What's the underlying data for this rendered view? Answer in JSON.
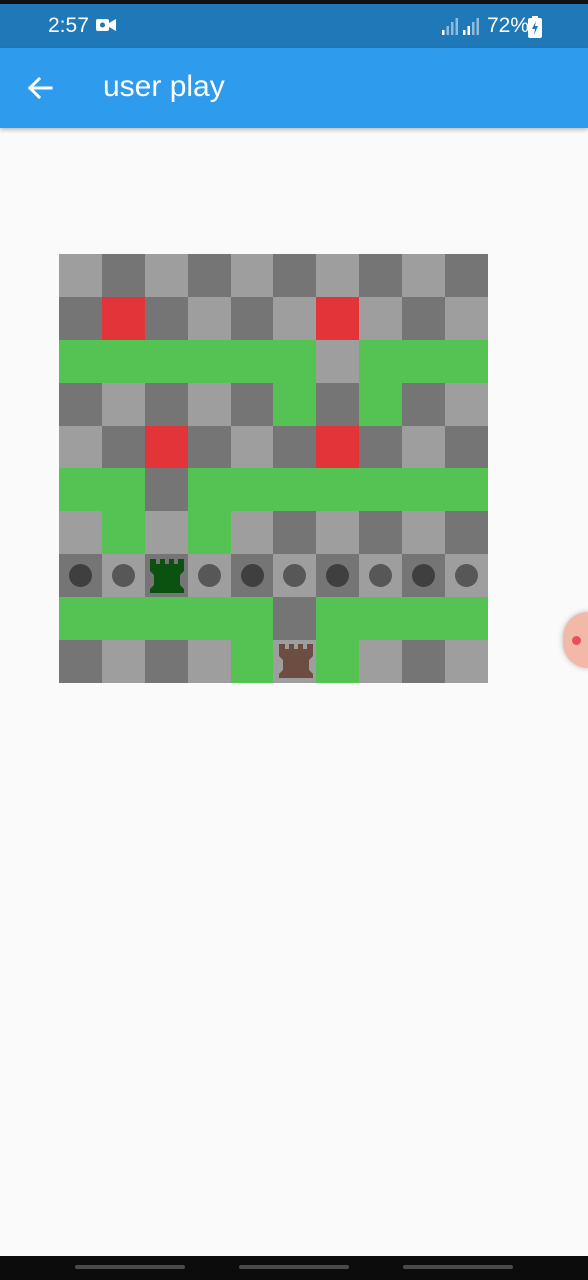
{
  "status_bar": {
    "time": "2:57",
    "battery": "72%",
    "icons": [
      "video-camera-icon",
      "signal-icon",
      "signal-icon",
      "battery-icon"
    ]
  },
  "app_bar": {
    "title": "user play",
    "back_icon": "arrow-left-icon"
  },
  "board": {
    "size": 10,
    "colors": {
      "L": "#9e9e9e",
      "D": "#757575",
      "G": "#54c354",
      "R": "#e33539",
      "green_piece": "#0b5211",
      "brown_piece": "#6d4c41"
    },
    "rows": [
      "LDLDLDLDLD",
      "DRDLDLRLDL",
      "GGGGGGLGGG",
      "DLDLDGDGDL",
      "LDRDLDRDLD",
      "GGDGGGGGGG",
      "LGLGLDLDLD",
      "DLDLDLDLDL",
      "GGGGGDGGGG",
      "DLDLGLGLDL"
    ],
    "pieces": [
      {
        "row": 7,
        "col": 2,
        "type": "rook",
        "color": "green"
      },
      {
        "row": 9,
        "col": 5,
        "type": "rook",
        "color": "brown"
      }
    ],
    "move_dots": [
      {
        "row": 7,
        "col": 0
      },
      {
        "row": 7,
        "col": 1
      },
      {
        "row": 7,
        "col": 3
      },
      {
        "row": 7,
        "col": 4
      },
      {
        "row": 7,
        "col": 5
      },
      {
        "row": 7,
        "col": 6
      },
      {
        "row": 7,
        "col": 7
      },
      {
        "row": 7,
        "col": 8
      },
      {
        "row": 7,
        "col": 9
      }
    ]
  }
}
